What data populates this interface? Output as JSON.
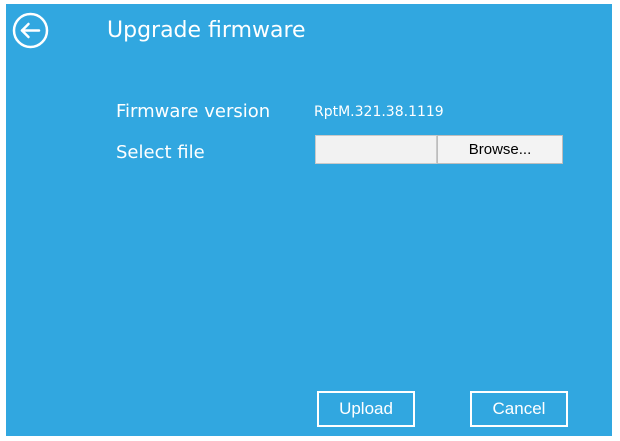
{
  "header": {
    "back_icon": "arrow-left-circle-icon",
    "title": "Upgrade firmware"
  },
  "form": {
    "firmware_version_label": "Firmware version",
    "firmware_version_value": "RptM.321.38.1119",
    "select_file_label": "Select file",
    "file_value": "",
    "browse_label": "Browse..."
  },
  "actions": {
    "upload_label": "Upload",
    "cancel_label": "Cancel"
  },
  "colors": {
    "background": "#31a7e0",
    "foreground": "#ffffff"
  }
}
